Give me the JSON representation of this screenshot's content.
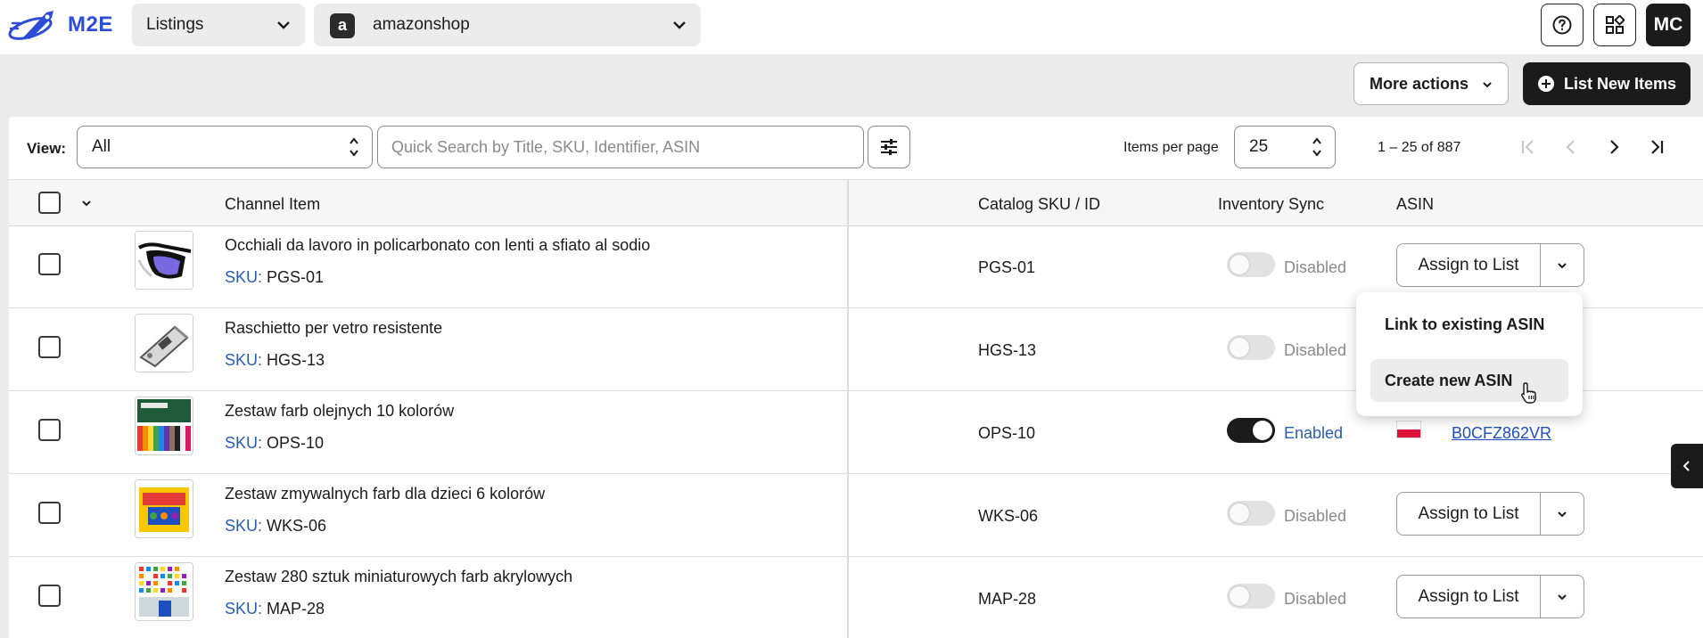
{
  "header": {
    "logo_text": "M2E",
    "listings_select": "Listings",
    "shop_select": "amazonshop",
    "shop_icon_letter": "a",
    "avatar_initials": "MC"
  },
  "actions": {
    "more_actions": "More actions",
    "list_new_items": "List New Items"
  },
  "toolbar": {
    "view_label": "View:",
    "view_value": "All",
    "search_placeholder": "Quick Search by Title, SKU, Identifier, ASIN",
    "items_per_page_label": "Items per page",
    "items_per_page_value": "25",
    "page_range": "1 – 25 of 887"
  },
  "table": {
    "columns": [
      "Channel Item",
      "Catalog SKU / ID",
      "Inventory Sync",
      "ASIN"
    ],
    "sku_prefix": "SKU:",
    "rows": [
      {
        "title": "Occhiali da lavoro in policarbonato con lenti a sfiato al sodio",
        "sku": "PGS-01",
        "catalog": "PGS-01",
        "sync": "Disabled",
        "sync_on": false,
        "asin_action": "Assign to List"
      },
      {
        "title": "Raschietto per vetro resistente",
        "sku": "HGS-13",
        "catalog": "HGS-13",
        "sync": "Disabled",
        "sync_on": false,
        "asin_action": ""
      },
      {
        "title": "Zestaw farb olejnych 10 kolorów",
        "sku": "OPS-10",
        "catalog": "OPS-10",
        "sync": "Enabled",
        "sync_on": true,
        "asin": "B0CFZ862VR"
      },
      {
        "title": "Zestaw zmywalnych farb dla dzieci 6 kolorów",
        "sku": "WKS-06",
        "catalog": "WKS-06",
        "sync": "Disabled",
        "sync_on": false,
        "asin_action": "Assign to List"
      },
      {
        "title": "Zestaw 280 sztuk miniaturowych farb akrylowych",
        "sku": "MAP-28",
        "catalog": "MAP-28",
        "sync": "Disabled",
        "sync_on": false,
        "asin_action": "Assign to List"
      }
    ]
  },
  "dropdown": {
    "items": [
      "Link to existing ASIN",
      "Create new ASIN"
    ],
    "highlighted_index": 1
  },
  "colors": {
    "brand": "#2d4dd8",
    "link": "#1f4fbf",
    "dark": "#1b1b1b"
  }
}
